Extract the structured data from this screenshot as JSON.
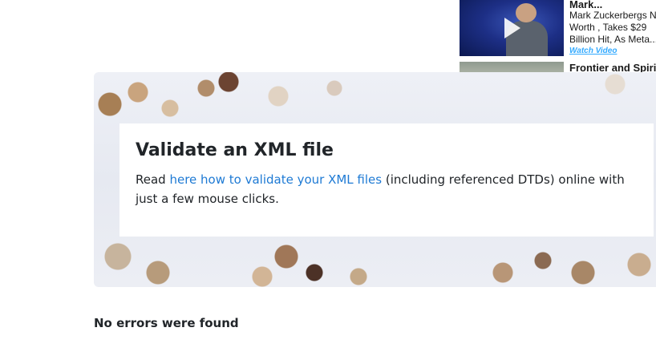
{
  "ad": {
    "item1": {
      "title": "Mark...",
      "desc_line1": "Mark Zuckerbergs Net",
      "desc_line2": "Worth , Takes $29",
      "desc_line3": "Billion Hit, As Meta...",
      "link": "Watch Video"
    },
    "item2": {
      "title": "Frontier and Spirit"
    }
  },
  "hero": {
    "heading": "Validate an XML file",
    "text_before": "Read ",
    "link_text": "here how to validate your XML files",
    "text_after": " (including referenced DTDs) online with just a few mouse clicks."
  },
  "status": {
    "message": "No errors were found"
  },
  "colors": {
    "link": "#1e7ad4",
    "ad_link": "#33aaff",
    "text": "#212529"
  }
}
